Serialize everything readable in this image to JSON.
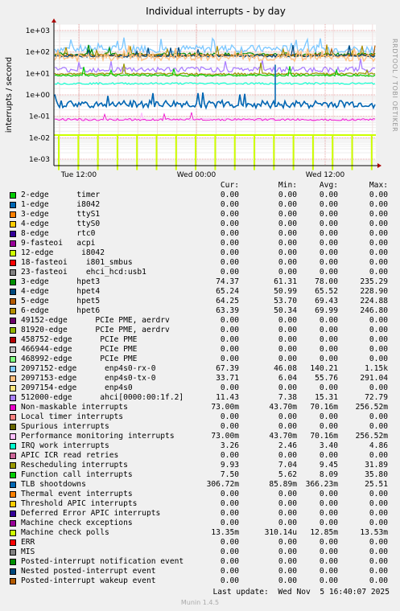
{
  "title": "Individual interrupts - by day",
  "watermark": "RRDTOOL / TOBI OETIKER",
  "footer": {
    "last_update": "Last update:  Wed Nov  5 16:40:07 2025",
    "munin": "Munin 1.4.5"
  },
  "legend_header": {
    "cur": "Cur:",
    "min": "Min:",
    "avg": "Avg:",
    "max": "Max:"
  },
  "chart_data": {
    "type": "line",
    "title": "Individual interrupts - by day",
    "ylabel": "interrupts / second",
    "yscale": "log",
    "ylim": [
      0.0005,
      2000
    ],
    "yticks": [
      "1e-03",
      "1e-02",
      "1e-01",
      "1e+00",
      "1e+01",
      "1e+02",
      "1e+03"
    ],
    "xticks": [
      "Tue 12:00",
      "Wed 00:00",
      "Wed 12:00"
    ],
    "grid": true,
    "series": [
      {
        "name": "2-edge      timer",
        "color": "#00cc00",
        "cur": "0.00",
        "min": "0.00",
        "avg": "0.00",
        "max": "0.00"
      },
      {
        "name": "1-edge      i8042",
        "color": "#0066b3",
        "cur": "0.00",
        "min": "0.00",
        "avg": "0.00",
        "max": "0.00"
      },
      {
        "name": "3-edge      ttyS1",
        "color": "#ff8000",
        "cur": "0.00",
        "min": "0.00",
        "avg": "0.00",
        "max": "0.00"
      },
      {
        "name": "4-edge      ttyS0",
        "color": "#ffcc00",
        "cur": "0.00",
        "min": "0.00",
        "avg": "0.00",
        "max": "0.00"
      },
      {
        "name": "8-edge      rtc0",
        "color": "#330099",
        "cur": "0.00",
        "min": "0.00",
        "avg": "0.00",
        "max": "0.00"
      },
      {
        "name": "9-fasteoi   acpi",
        "color": "#990099",
        "cur": "0.00",
        "min": "0.00",
        "avg": "0.00",
        "max": "0.00"
      },
      {
        "name": "12-edge      i8042",
        "color": "#ccff00",
        "cur": "0.00",
        "min": "0.00",
        "avg": "0.00",
        "max": "0.00"
      },
      {
        "name": "18-fasteoi    i801_smbus",
        "color": "#ff0000",
        "cur": "0.00",
        "min": "0.00",
        "avg": "0.00",
        "max": "0.00"
      },
      {
        "name": "23-fasteoi    ehci_hcd:usb1",
        "color": "#808080",
        "cur": "0.00",
        "min": "0.00",
        "avg": "0.00",
        "max": "0.00"
      },
      {
        "name": "3-edge      hpet3",
        "color": "#008f00",
        "cur": "74.37",
        "min": "61.31",
        "avg": "78.00",
        "max": "235.29"
      },
      {
        "name": "4-edge      hpet4",
        "color": "#00487d",
        "cur": "65.24",
        "min": "50.99",
        "avg": "65.52",
        "max": "228.90"
      },
      {
        "name": "5-edge      hpet5",
        "color": "#b35a00",
        "cur": "64.25",
        "min": "53.70",
        "avg": "69.43",
        "max": "224.88"
      },
      {
        "name": "6-edge      hpet6",
        "color": "#b38f00",
        "cur": "63.39",
        "min": "50.34",
        "avg": "69.99",
        "max": "246.80"
      },
      {
        "name": "49152-edge      PCIe PME, aerdrv",
        "color": "#6b006b",
        "cur": "0.00",
        "min": "0.00",
        "avg": "0.00",
        "max": "0.00"
      },
      {
        "name": "81920-edge      PCIe PME, aerdrv",
        "color": "#8fb300",
        "cur": "0.00",
        "min": "0.00",
        "avg": "0.00",
        "max": "0.00"
      },
      {
        "name": "458752-edge      PCIe PME",
        "color": "#b30000",
        "cur": "0.00",
        "min": "0.00",
        "avg": "0.00",
        "max": "0.00"
      },
      {
        "name": "466944-edge      PCIe PME",
        "color": "#bebebe",
        "cur": "0.00",
        "min": "0.00",
        "avg": "0.00",
        "max": "0.00"
      },
      {
        "name": "468992-edge      PCIe PME",
        "color": "#80ff80",
        "cur": "0.00",
        "min": "0.00",
        "avg": "0.00",
        "max": "0.00"
      },
      {
        "name": "2097152-edge      enp4s0-rx-0",
        "color": "#80c9ff",
        "cur": "67.39",
        "min": "46.08",
        "avg": "140.21",
        "max": "1.15k"
      },
      {
        "name": "2097153-edge      enp4s0-tx-0",
        "color": "#ffc080",
        "cur": "33.71",
        "min": "6.04",
        "avg": "55.76",
        "max": "291.04"
      },
      {
        "name": "2097154-edge      enp4s0",
        "color": "#ffe680",
        "cur": "0.00",
        "min": "0.00",
        "avg": "0.00",
        "max": "0.00"
      },
      {
        "name": "512000-edge      ahci[0000:00:1f.2]",
        "color": "#aa80ff",
        "cur": "11.43",
        "min": "7.38",
        "avg": "15.31",
        "max": "72.79"
      },
      {
        "name": "Non-maskable interrupts",
        "color": "#ee00cc",
        "cur": "73.00m",
        "min": "43.70m",
        "avg": "70.16m",
        "max": "256.52m"
      },
      {
        "name": "Local timer interrupts",
        "color": "#ff8080",
        "cur": "0.00",
        "min": "0.00",
        "avg": "0.00",
        "max": "0.00"
      },
      {
        "name": "Spurious interrupts",
        "color": "#666600",
        "cur": "0.00",
        "min": "0.00",
        "avg": "0.00",
        "max": "0.00"
      },
      {
        "name": "Performance monitoring interrupts",
        "color": "#ffbfff",
        "cur": "73.00m",
        "min": "43.70m",
        "avg": "70.16m",
        "max": "256.52m"
      },
      {
        "name": "IRQ work interrupts",
        "color": "#00ffcc",
        "cur": "3.26",
        "min": "2.46",
        "avg": "3.40",
        "max": "4.86"
      },
      {
        "name": "APIC ICR read retries",
        "color": "#cc6699",
        "cur": "0.00",
        "min": "0.00",
        "avg": "0.00",
        "max": "0.00"
      },
      {
        "name": "Rescheduling interrupts",
        "color": "#999900",
        "cur": "9.93",
        "min": "7.04",
        "avg": "9.45",
        "max": "31.89"
      },
      {
        "name": "Function call interrupts",
        "color": "#00cc00",
        "cur": "7.50",
        "min": "5.62",
        "avg": "8.09",
        "max": "35.80"
      },
      {
        "name": "TLB shootdowns",
        "color": "#0066b3",
        "cur": "306.72m",
        "min": "85.89m",
        "avg": "366.23m",
        "max": "25.51"
      },
      {
        "name": "Thermal event interrupts",
        "color": "#ff8000",
        "cur": "0.00",
        "min": "0.00",
        "avg": "0.00",
        "max": "0.00"
      },
      {
        "name": "Threshold APIC interrupts",
        "color": "#ffcc00",
        "cur": "0.00",
        "min": "0.00",
        "avg": "0.00",
        "max": "0.00"
      },
      {
        "name": "Deferred Error APIC interrupts",
        "color": "#330099",
        "cur": "0.00",
        "min": "0.00",
        "avg": "0.00",
        "max": "0.00"
      },
      {
        "name": "Machine check exceptions",
        "color": "#990099",
        "cur": "0.00",
        "min": "0.00",
        "avg": "0.00",
        "max": "0.00"
      },
      {
        "name": "Machine check polls",
        "color": "#ccff00",
        "cur": "13.35m",
        "min": "310.14u",
        "avg": "12.85m",
        "max": "13.53m"
      },
      {
        "name": "ERR",
        "color": "#ff0000",
        "cur": "0.00",
        "min": "0.00",
        "avg": "0.00",
        "max": "0.00"
      },
      {
        "name": "MIS",
        "color": "#808080",
        "cur": "0.00",
        "min": "0.00",
        "avg": "0.00",
        "max": "0.00"
      },
      {
        "name": "Posted-interrupt notification event",
        "color": "#008f00",
        "cur": "0.00",
        "min": "0.00",
        "avg": "0.00",
        "max": "0.00"
      },
      {
        "name": "Nested posted-interrupt event",
        "color": "#00487d",
        "cur": "0.00",
        "min": "0.00",
        "avg": "0.00",
        "max": "0.00"
      },
      {
        "name": "Posted-interrupt wakeup event",
        "color": "#b35a00",
        "cur": "0.00",
        "min": "0.00",
        "avg": "0.00",
        "max": "0.00"
      }
    ]
  }
}
